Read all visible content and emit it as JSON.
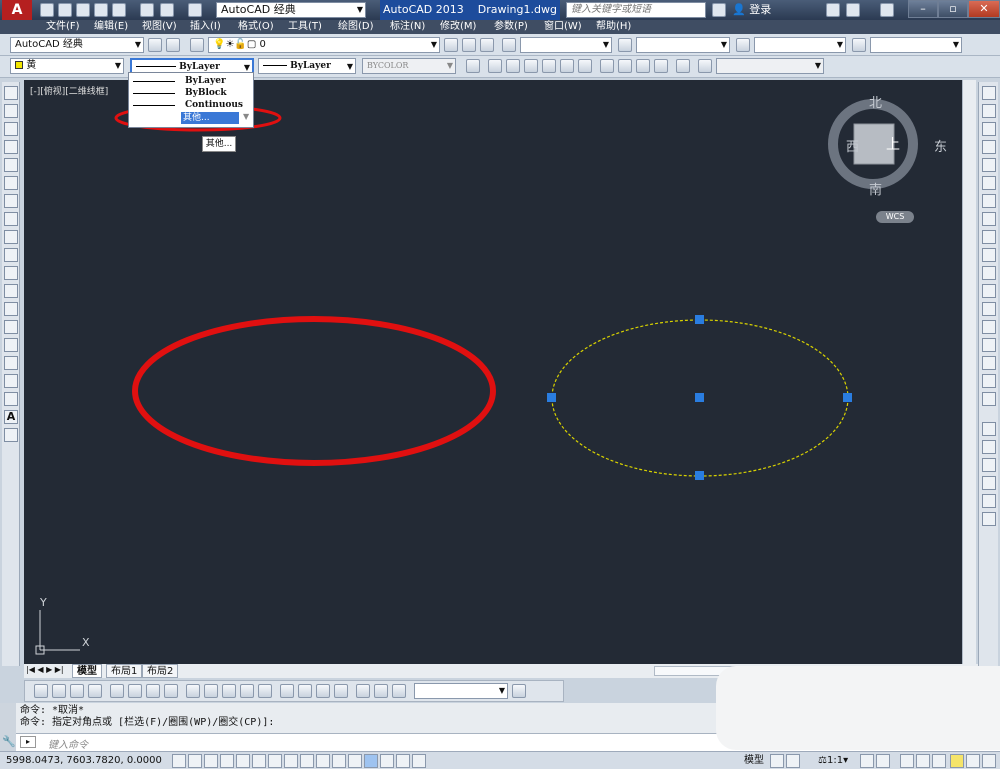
{
  "titlebar": {
    "workspace": "AutoCAD 经典",
    "app_name": "AutoCAD 2013",
    "document": "Drawing1.dwg",
    "search_placeholder": "键入关键字或短语",
    "login": "登录"
  },
  "menubar": {
    "items": [
      "文件(F)",
      "编辑(E)",
      "视图(V)",
      "插入(I)",
      "格式(O)",
      "工具(T)",
      "绘图(D)",
      "标注(N)",
      "修改(M)",
      "参数(P)",
      "窗口(W)",
      "帮助(H)"
    ]
  },
  "toolbar": {
    "workspace_combo": "AutoCAD 经典",
    "layer_combo": "0",
    "color_combo": "黄",
    "linetype_combo": "ByLayer",
    "lineweight_combo": "ByLayer",
    "plotstyle_combo": "BYCOLOR"
  },
  "linetype_dropdown": {
    "options": [
      "ByLayer",
      "ByBlock",
      "Continuous",
      "其他..."
    ],
    "tooltip": "其他..."
  },
  "viewport": {
    "label": "[-][俯视][二维线框]"
  },
  "viewcube": {
    "north": "北",
    "south": "南",
    "west": "西",
    "east": "东",
    "top_face": "上",
    "wcs": "WCS"
  },
  "ucs": {
    "x": "X",
    "y": "Y"
  },
  "layout_tabs": [
    "模型",
    "布局1",
    "布局2"
  ],
  "command": {
    "history": [
      "命令: *取消*",
      "命令: 指定对角点或 [栏选(F)/圈围(WP)/圈交(CP)]:"
    ],
    "input_placeholder": "键入命令"
  },
  "status": {
    "coordinates": "5998.0473, 7603.7820, 0.0000",
    "model_label": "模型",
    "scale": "1:1"
  },
  "colors": {
    "canvas": "#232a35",
    "selected_ellipse": "#d8d200",
    "grip": "#2a7de0",
    "annotation_red": "#e01010"
  }
}
